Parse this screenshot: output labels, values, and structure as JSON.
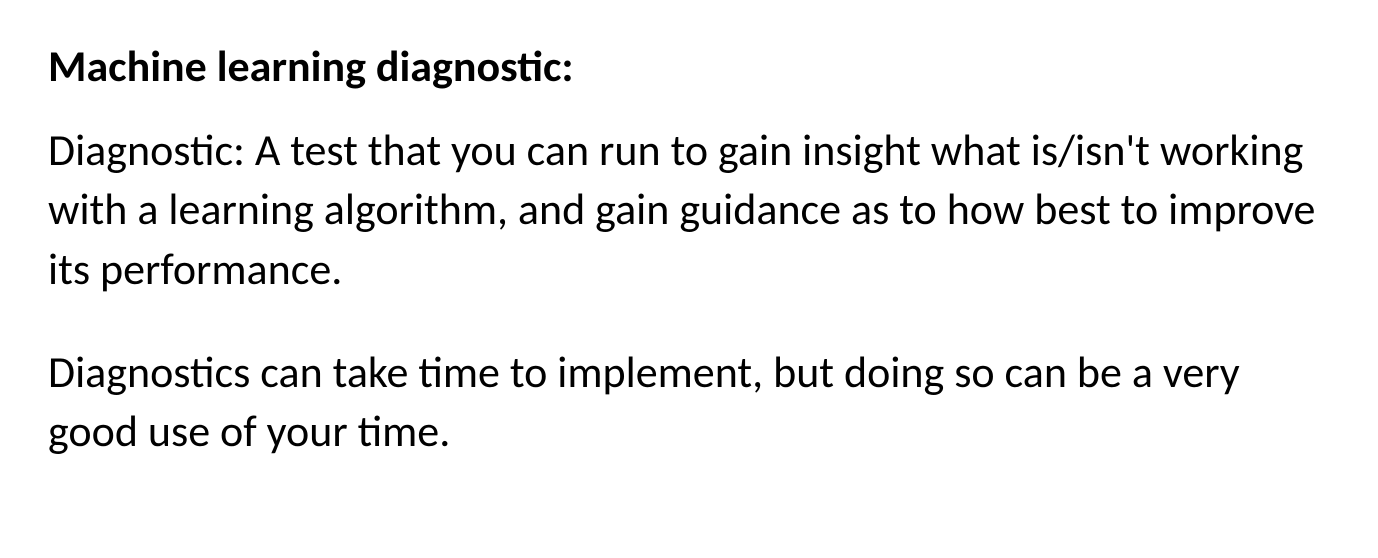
{
  "slide": {
    "heading": "Machine learning diagnostic:",
    "paragraph1": "Diagnostic: A test that you can run to gain insight what is/isn't working with a learning algorithm, and gain guidance as to how best to improve its performance.",
    "paragraph2": "Diagnostics can take time to implement, but doing so can be a very good use of your time."
  }
}
